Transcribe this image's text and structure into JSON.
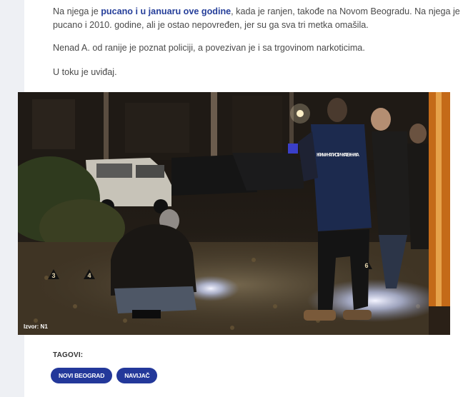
{
  "article": {
    "para1_pre": "Na njega je ",
    "para1_link": "pucano i u januaru ove godine",
    "para1_post": ", kada je ranjen, takođe na Novom Beogradu. Na njega je pucano i 2010. godine, ali je ostao nepovređen, jer su ga sva tri metka omašila.",
    "para2": "Nenad A. od ranije je poznat policiji, a povezivan je i sa trgovinom narkoticima.",
    "para3": "U toku je uviđaj."
  },
  "photo": {
    "caption": "Izvor: N1",
    "vest_text": "КРИМИНАЛИСТИЧКА ТЕХНИКА",
    "markers": [
      "3",
      "4",
      "6"
    ]
  },
  "tags": {
    "label": "TAGOVI:",
    "items": [
      "NOVI BEOGRAD",
      "NAVIJAČ"
    ]
  },
  "colors": {
    "link": "#263f9a",
    "tag_bg": "#23389a"
  }
}
